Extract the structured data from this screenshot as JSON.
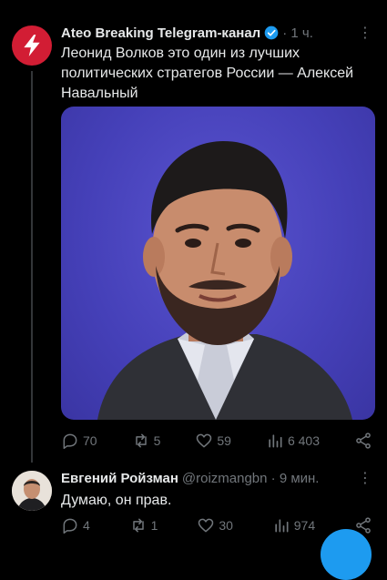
{
  "tweet1": {
    "author_name": "Ateo Breaking Telegram-канал",
    "time": "· 1 ч.",
    "text": "Леонид Волков это один из лучших политических стратегов России — Алексей Навальный",
    "stats": {
      "replies": "70",
      "retweets": "5",
      "likes": "59",
      "views": "6 403"
    }
  },
  "tweet2": {
    "author_name": "Евгений Ройзман",
    "handle_time": "@roizmangbn · 9 мин.",
    "text": "Думаю, он прав.",
    "stats": {
      "replies": "4",
      "retweets": "1",
      "likes": "30",
      "views": "974"
    }
  },
  "colors": {
    "brand_red": "#d21d34",
    "verified_blue": "#1d9bf0",
    "muted": "#71767b",
    "media_bg": "#4a44c4"
  },
  "icons": [
    "lightning-icon",
    "verified-badge-icon",
    "more-icon",
    "reply-icon",
    "retweet-icon",
    "like-icon",
    "views-icon",
    "share-icon"
  ]
}
